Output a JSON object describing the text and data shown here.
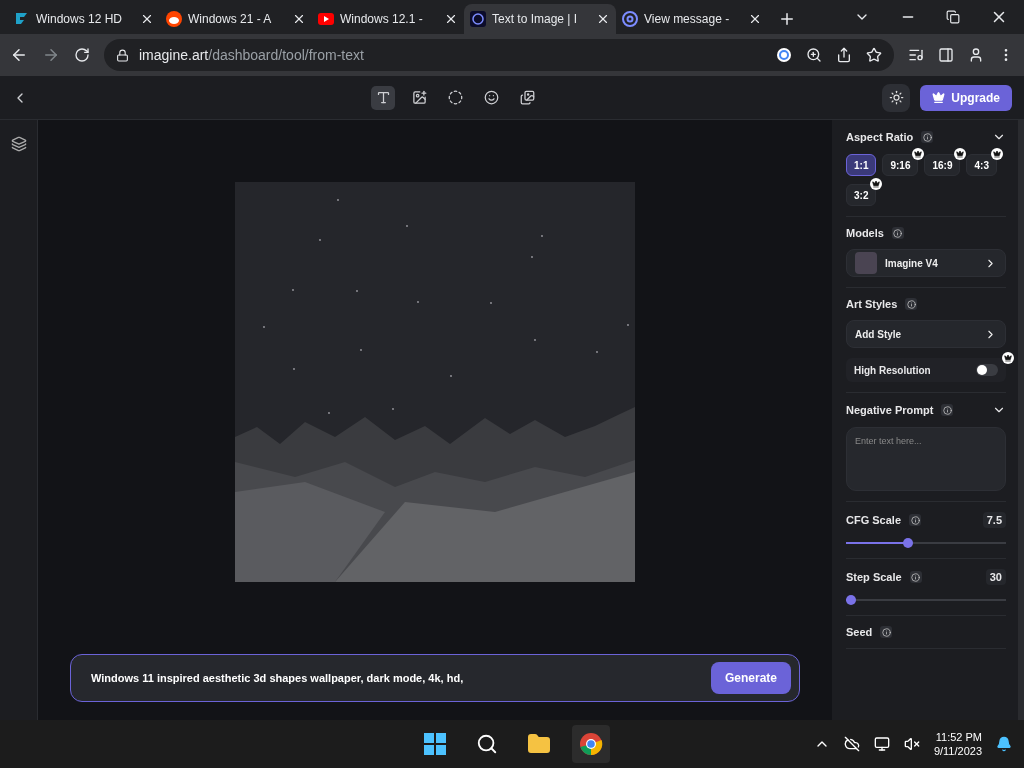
{
  "browser": {
    "tabs": [
      {
        "title": "Windows 12 HD",
        "kind": "feather",
        "selected": false
      },
      {
        "title": "Windows 21 - A",
        "kind": "reddit",
        "selected": false
      },
      {
        "title": "Windows 12.1 -",
        "kind": "youtube",
        "selected": false
      },
      {
        "title": "Text to Image | I",
        "kind": "ring",
        "selected": true
      },
      {
        "title": "View message -",
        "kind": "at",
        "selected": false
      }
    ],
    "address": {
      "host": "imagine.art",
      "path": "/dashboard/tool/from-text"
    }
  },
  "header": {
    "tools": [
      {
        "selected": true
      },
      {
        "selected": false
      },
      {
        "selected": false
      },
      {
        "selected": false
      },
      {
        "selected": false
      }
    ],
    "upgrade": "Upgrade"
  },
  "panel": {
    "aspect_ratio": {
      "title": "Aspect Ratio",
      "options": [
        {
          "label": "1:1",
          "selected": true,
          "premium": false
        },
        {
          "label": "9:16",
          "selected": false,
          "premium": true
        },
        {
          "label": "16:9",
          "selected": false,
          "premium": true
        },
        {
          "label": "4:3",
          "selected": false,
          "premium": true
        },
        {
          "label": "3:2",
          "selected": false,
          "premium": true
        }
      ]
    },
    "models": {
      "title": "Models",
      "model": "Imagine V4"
    },
    "art_styles": {
      "title": "Art Styles",
      "add": "Add Style",
      "high_resolution": {
        "label": "High Resolution",
        "on": false
      }
    },
    "negative_prompt": {
      "title": "Negative Prompt",
      "placeholder": "Enter text here..."
    },
    "sliders": [
      {
        "title": "CFG Scale",
        "reading": "7.5",
        "level": 0.38
      },
      {
        "title": "Step Scale",
        "reading": "30",
        "level": 0
      }
    ],
    "seed": {
      "title": "Seed"
    }
  },
  "prompt": {
    "value": "Windows 11 inspired aesthetic 3d shapes wallpaper, dark mode, 4k, hd,",
    "button": "Generate"
  },
  "taskbar": {
    "time": "11:52 PM",
    "date": "9/11/2023"
  }
}
